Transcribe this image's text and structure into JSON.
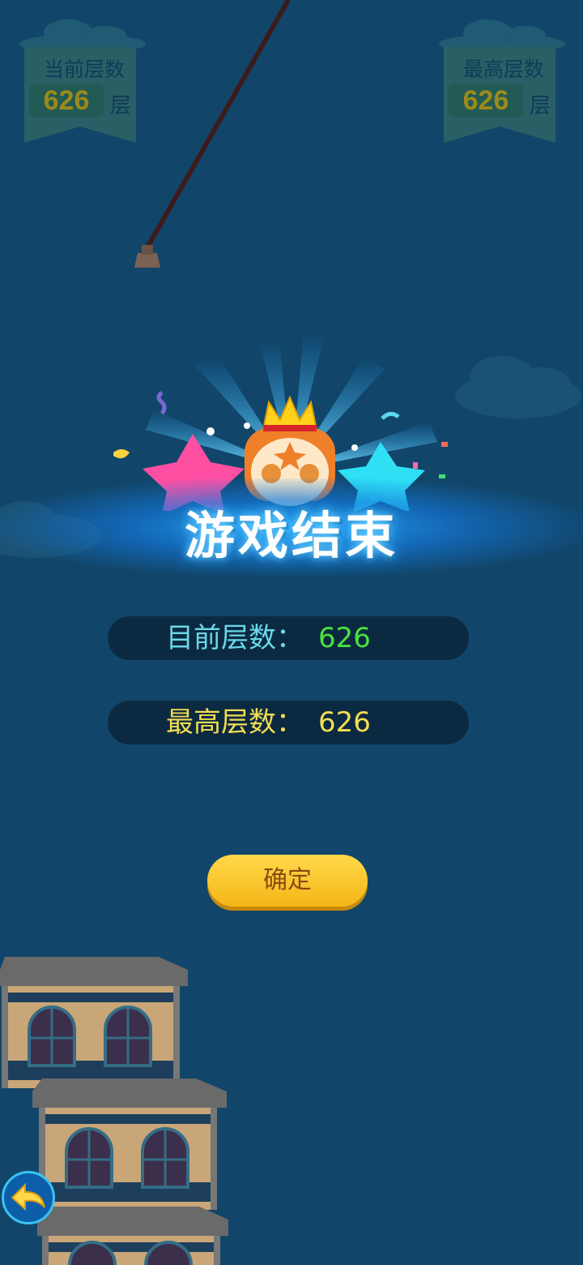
{
  "hud": {
    "current": {
      "label": "当前层数",
      "value": "626",
      "unit": "层"
    },
    "best": {
      "label": "最高层数",
      "value": "626",
      "unit": "层"
    }
  },
  "game_over": {
    "title": "游戏结束",
    "current_label": "目前层数：",
    "current_value": "626",
    "best_label": "最高层数：",
    "best_value": "626",
    "confirm_label": "确定"
  },
  "colors": {
    "background": "#11466a",
    "accent_yellow": "#f5c21a",
    "current_value": "#4ae23d",
    "current_label": "#6ad8e8",
    "best_text": "#f3dc52"
  },
  "icons": {
    "back": "back-arrow-icon",
    "mascot": "crowned-fox-mascot"
  }
}
